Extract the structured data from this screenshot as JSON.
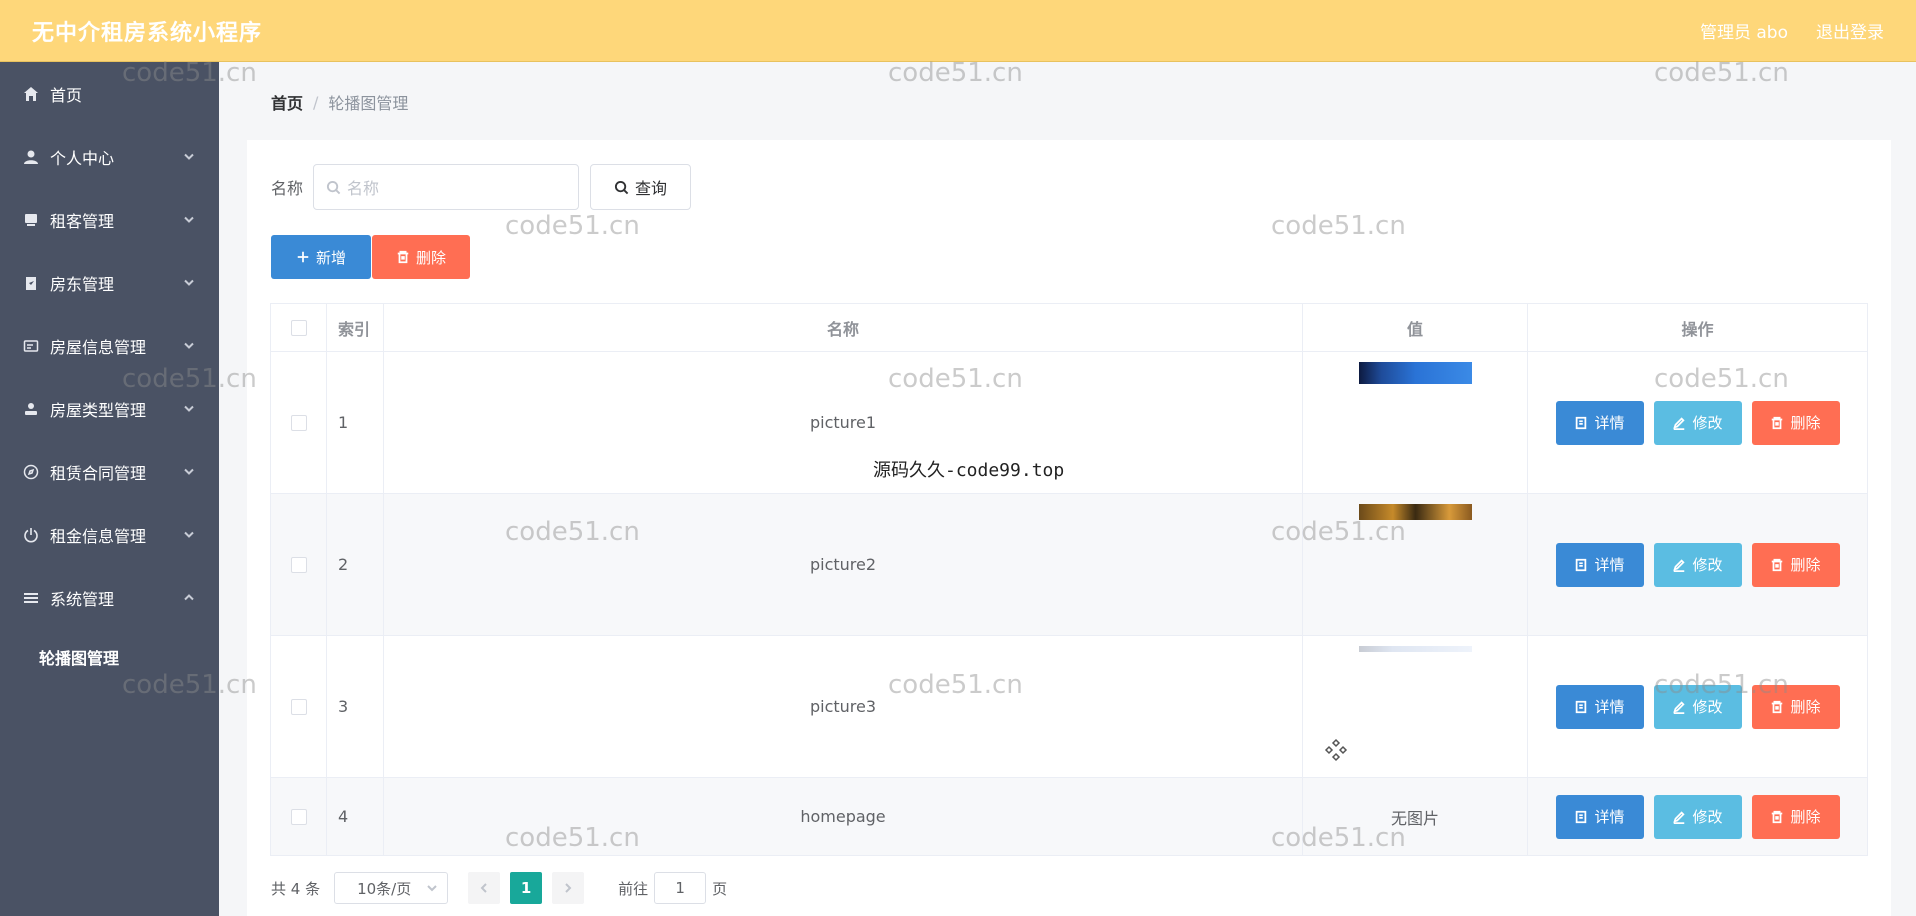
{
  "header": {
    "title": "无中介租房系统小程序",
    "admin": "管理员 abo",
    "logout": "退出登录"
  },
  "sidebar": {
    "items": [
      {
        "label": "首页",
        "icon": "home-icon"
      },
      {
        "label": "个人中心",
        "icon": "user-icon"
      },
      {
        "label": "租客管理",
        "icon": "tenant-icon"
      },
      {
        "label": "房东管理",
        "icon": "clipboard-icon"
      },
      {
        "label": "房屋信息管理",
        "icon": "card-icon"
      },
      {
        "label": "房屋类型管理",
        "icon": "person-icon"
      },
      {
        "label": "租赁合同管理",
        "icon": "compass-icon"
      },
      {
        "label": "租金信息管理",
        "icon": "power-icon"
      },
      {
        "label": "系统管理",
        "icon": "menu-icon"
      }
    ],
    "sub_item": "轮播图管理"
  },
  "breadcrumb": {
    "home": "首页",
    "sep": "/",
    "current": "轮播图管理"
  },
  "search": {
    "label": "名称",
    "placeholder": "名称",
    "button": "查询"
  },
  "actions": {
    "add": "新增",
    "delete": "删除"
  },
  "table": {
    "headers": {
      "index": "索引",
      "name": "名称",
      "value": "值",
      "ops": "操作"
    },
    "rows": [
      {
        "index": "1",
        "name": "picture1"
      },
      {
        "index": "2",
        "name": "picture2"
      },
      {
        "index": "3",
        "name": "picture3"
      },
      {
        "index": "4",
        "name": "homepage",
        "value_text": "无图片"
      }
    ],
    "row_buttons": {
      "detail": "详情",
      "edit": "修改",
      "delete": "删除"
    }
  },
  "pager": {
    "total": "共 4 条",
    "page_size": "10条/页",
    "current_page": "1",
    "goto_label": "前往",
    "goto_value": "1",
    "goto_suffix": "页"
  },
  "watermarks": {
    "site": "code51.cn",
    "overlay": "源码久久-code99.top"
  },
  "colors": {
    "topbar": "#fed77a",
    "sidebar": "#4a5264",
    "primary": "#3a8ad6",
    "danger": "#ff6e53",
    "info": "#5bbde2",
    "pager_active": "#18a89a"
  }
}
